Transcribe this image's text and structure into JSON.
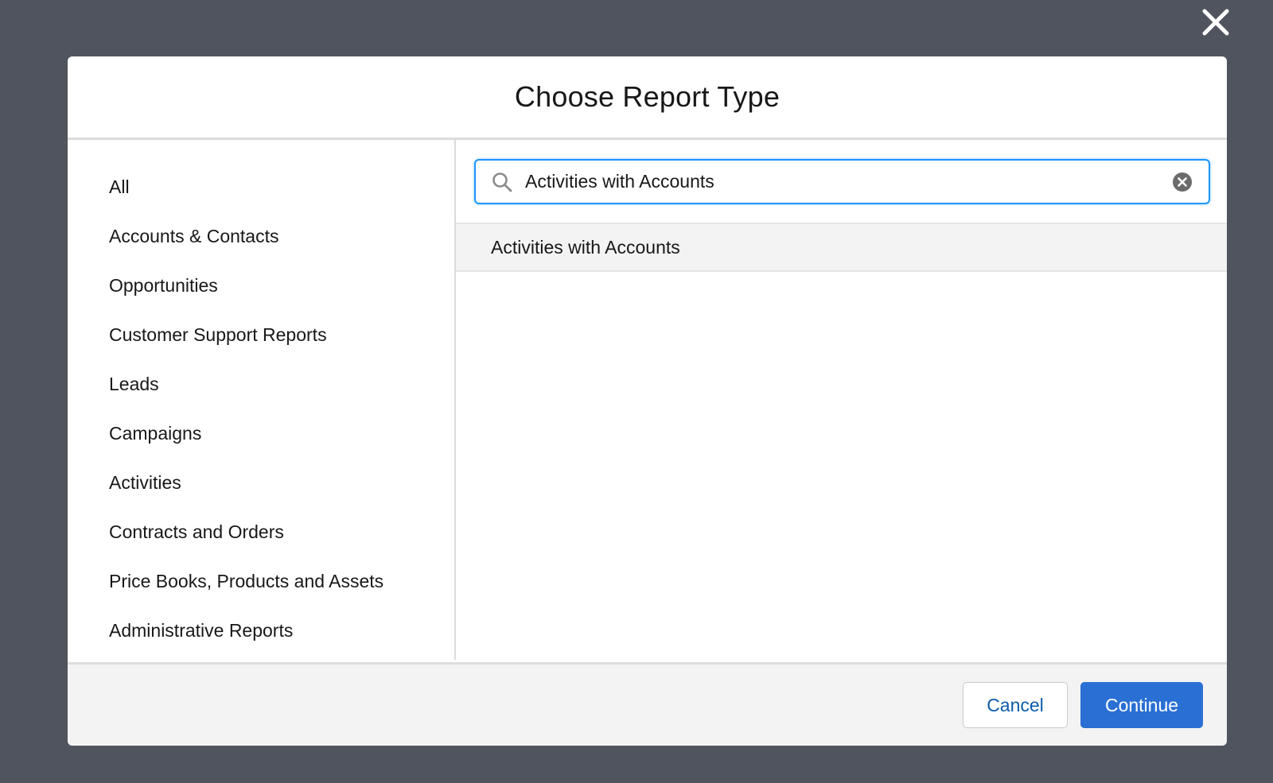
{
  "modal": {
    "title": "Choose Report Type"
  },
  "sidebar": {
    "items": [
      {
        "label": "All"
      },
      {
        "label": "Accounts & Contacts"
      },
      {
        "label": "Opportunities"
      },
      {
        "label": "Customer Support Reports"
      },
      {
        "label": "Leads"
      },
      {
        "label": "Campaigns"
      },
      {
        "label": "Activities"
      },
      {
        "label": "Contracts and Orders"
      },
      {
        "label": "Price Books, Products and Assets"
      },
      {
        "label": "Administrative Reports"
      }
    ]
  },
  "search": {
    "value": "Activities with Accounts",
    "icon": "search-icon",
    "clear_icon": "clear-circle-icon"
  },
  "results": [
    {
      "label": "Activities with Accounts"
    }
  ],
  "footer": {
    "cancel_label": "Cancel",
    "continue_label": "Continue"
  },
  "colors": {
    "overlay": "#4f545e",
    "brand": "#2a70d4",
    "focus": "#1b96ff",
    "link": "#0b5cab"
  }
}
